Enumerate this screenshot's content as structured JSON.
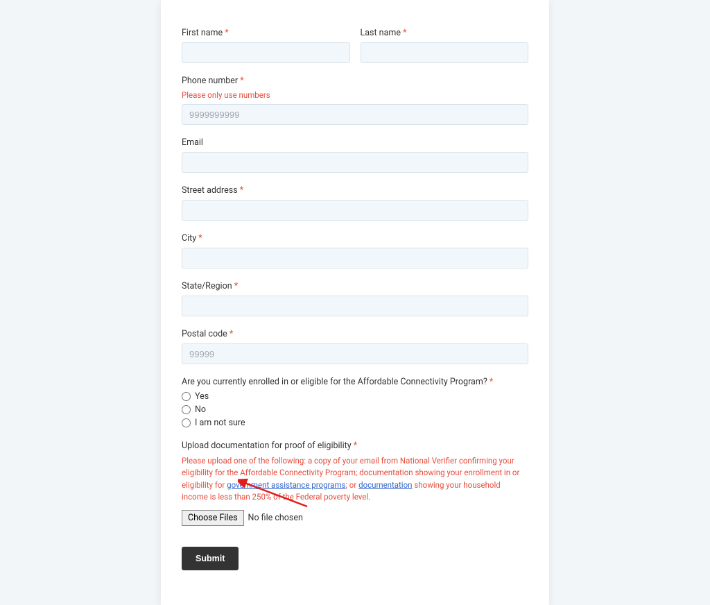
{
  "form": {
    "firstName": {
      "label": "First name",
      "value": ""
    },
    "lastName": {
      "label": "Last name",
      "value": ""
    },
    "phone": {
      "label": "Phone number",
      "hint": "Please only use numbers",
      "placeholder": "9999999999",
      "value": ""
    },
    "email": {
      "label": "Email",
      "value": ""
    },
    "street": {
      "label": "Street address",
      "value": ""
    },
    "city": {
      "label": "City",
      "value": ""
    },
    "state": {
      "label": "State/Region",
      "value": ""
    },
    "postal": {
      "label": "Postal code",
      "placeholder": "99999",
      "value": ""
    },
    "acp": {
      "question": "Are you currently enrolled in or eligible for the Affordable Connectivity Program?",
      "options": {
        "yes": "Yes",
        "no": "No",
        "unsure": "I am not sure"
      }
    },
    "upload": {
      "label": "Upload documentation for proof of eligibility",
      "desc_pre": "Please upload one of the following: a copy of your email from National Verifier confirming your eligibility for the Affordable Connectivity Program; documentation showing your enrollment in or eligibility for ",
      "link1": "government assistance programs",
      "desc_mid": "; or ",
      "link2": "documentation",
      "desc_post": " showing your household income is less than 250% of the Federal poverty level.",
      "button": "Choose Files",
      "status": "No file chosen"
    },
    "submit": "Submit"
  }
}
